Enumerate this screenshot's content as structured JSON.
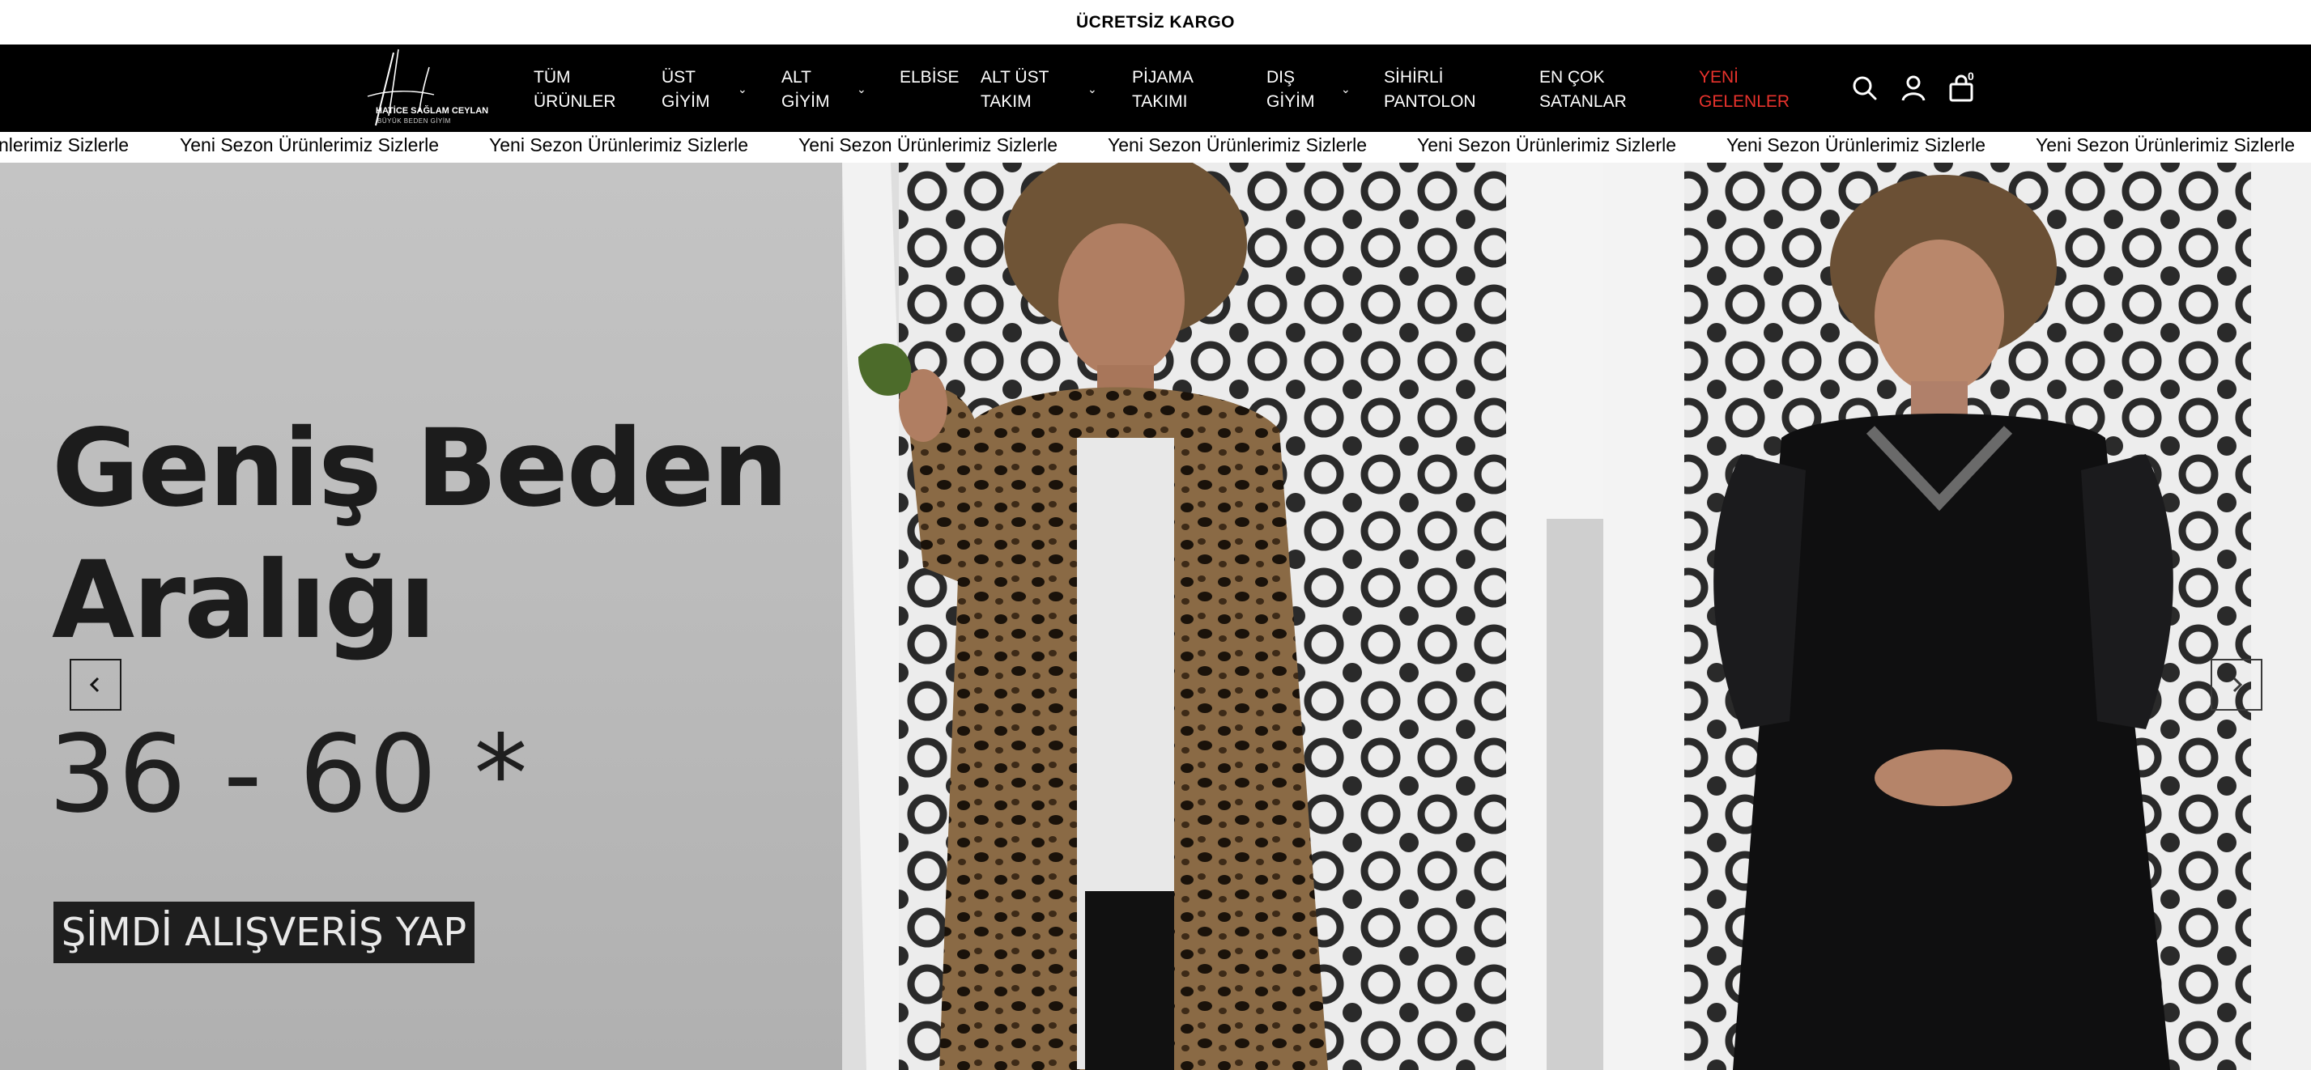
{
  "announcement": {
    "text": "ÜCRETSİZ KARGO"
  },
  "brand": {
    "name": "HATİCE SAĞLAM CEYLAN",
    "tagline": "BÜYÜK BEDEN GİYİM"
  },
  "nav": {
    "items": [
      {
        "line1": "TÜM",
        "line2": "ÜRÜNLER",
        "has_dropdown": false
      },
      {
        "line1": "ÜST",
        "line2": "GİYİM",
        "has_dropdown": true
      },
      {
        "line1": "ALT",
        "line2": "GİYİM",
        "has_dropdown": true
      },
      {
        "line1": "ELBİSE",
        "line2": "",
        "has_dropdown": false
      },
      {
        "line1": "ALT ÜST",
        "line2": "TAKIM",
        "has_dropdown": true
      },
      {
        "line1": "PİJAMA",
        "line2": "TAKIMI",
        "has_dropdown": false
      },
      {
        "line1": "DIŞ",
        "line2": "GİYİM",
        "has_dropdown": true
      },
      {
        "line1": "SİHİRLİ",
        "line2": "PANTOLON",
        "has_dropdown": false
      },
      {
        "line1": "EN ÇOK",
        "line2": "SATANLAR",
        "has_dropdown": false
      },
      {
        "line1": "YENİ",
        "line2": "GELENLER",
        "has_dropdown": false,
        "highlight_color": "#e8322c"
      }
    ],
    "icons": [
      "search-icon",
      "user-icon",
      "cart-icon"
    ],
    "cart_count": "0"
  },
  "marquee": {
    "first_partial": "nlerimiz Sizlerle",
    "text": "Yeni Sezon Ürünlerimiz Sizlerle",
    "repeat": 7
  },
  "hero": {
    "heading_line1": "Geniş Beden",
    "heading_line2": "Aralığı",
    "range": "36 - 60 *",
    "cta": "ŞİMDİ ALIŞVERİŞ YAP",
    "prev_icon": "chevron-left-icon",
    "next_icon": "chevron-right-icon",
    "slide_left": "Model in leopard print jacket over white top",
    "slide_right": "Model in black blouse with sparkle neckline"
  },
  "colors": {
    "nav_bg": "#000000",
    "accent": "#e8322c",
    "hero_bg": "#bdbdbd"
  }
}
